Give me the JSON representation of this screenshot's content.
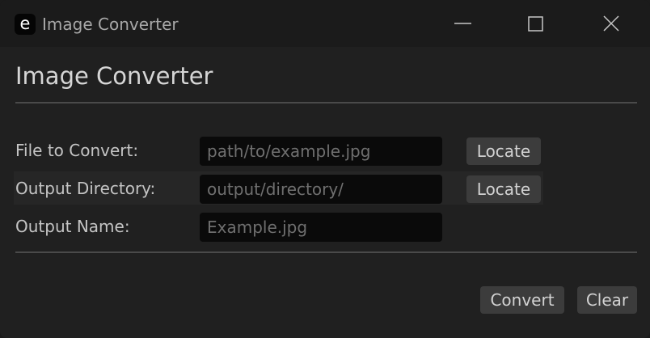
{
  "window": {
    "app_icon_letter": "e",
    "title": "Image Converter",
    "controls": {
      "minimize": "minimize-icon",
      "maximize": "maximize-icon",
      "close": "close-icon"
    }
  },
  "main": {
    "heading": "Image Converter",
    "rows": [
      {
        "label": "File to Convert:",
        "placeholder": "path/to/example.jpg",
        "value": "",
        "button": "Locate"
      },
      {
        "label": "Output Directory:",
        "placeholder": "output/directory/",
        "value": "",
        "button": "Locate"
      },
      {
        "label": "Output Name:",
        "placeholder": "Example.jpg",
        "value": ""
      }
    ],
    "actions": {
      "convert": "Convert",
      "clear": "Clear"
    }
  },
  "colors": {
    "window_bg": "#1b1b1b",
    "content_bg": "#202020",
    "field_bg": "#0a0a0a",
    "button_bg": "#3c3c3c",
    "divider": "#4a4a4a"
  }
}
